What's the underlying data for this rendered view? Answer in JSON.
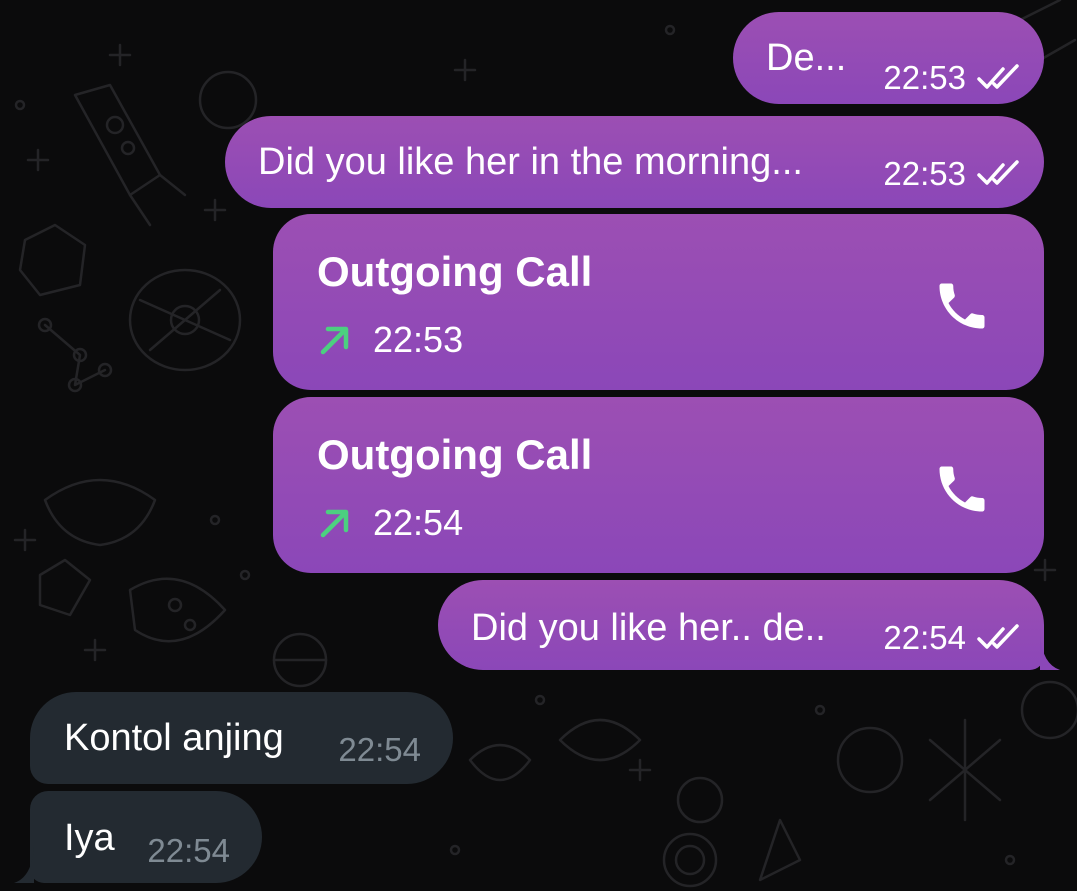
{
  "messages": [
    {
      "type": "text",
      "direction": "outgoing",
      "text": "De...",
      "time": "22:53",
      "status": "read"
    },
    {
      "type": "text",
      "direction": "outgoing",
      "text": "Did you like her in the morning...",
      "time": "22:53",
      "status": "read"
    },
    {
      "type": "call",
      "direction": "outgoing",
      "title": "Outgoing Call",
      "time": "22:53"
    },
    {
      "type": "call",
      "direction": "outgoing",
      "title": "Outgoing Call",
      "time": "22:54"
    },
    {
      "type": "text",
      "direction": "outgoing",
      "text": "Did you like her.. de..",
      "time": "22:54",
      "status": "read"
    },
    {
      "type": "text",
      "direction": "incoming",
      "text": "Kontol anjing",
      "time": "22:54"
    },
    {
      "type": "text",
      "direction": "incoming",
      "text": "Iya",
      "time": "22:54"
    }
  ],
  "icons": {
    "read_status": "double-check-icon",
    "call_action": "phone-icon",
    "call_direction": "arrow-up-right-icon"
  },
  "colors": {
    "background": "#0b0b0c",
    "outgoing_bubble": "#8f49b5",
    "incoming_bubble": "#232a31",
    "call_arrow": "#4cd080",
    "incoming_time": "#7f8a93"
  }
}
